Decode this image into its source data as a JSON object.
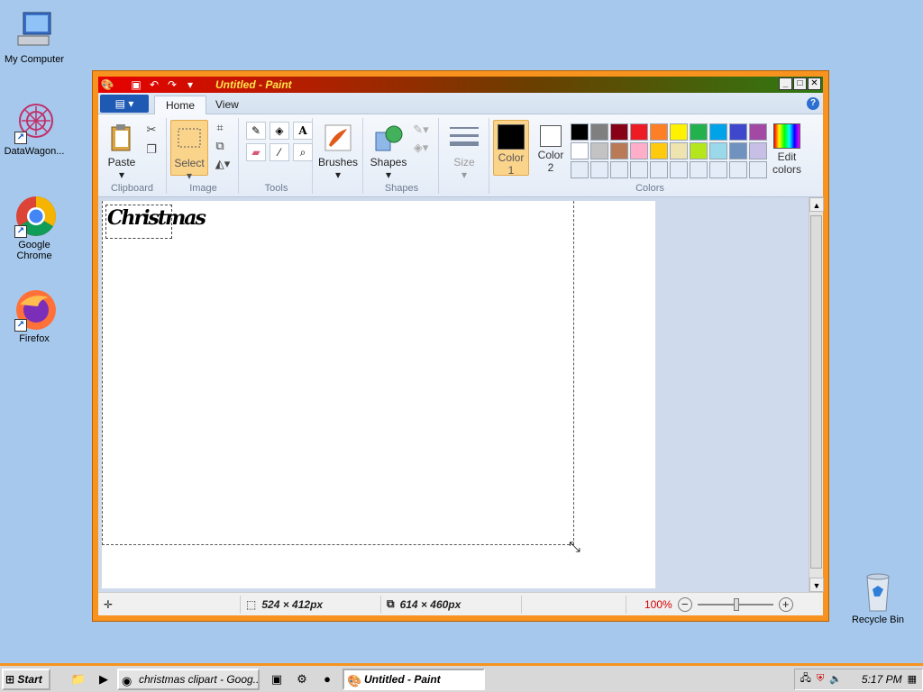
{
  "desktop": {
    "icons": [
      {
        "label": "My Computer"
      },
      {
        "label": "DataWagon..."
      },
      {
        "label": "Google Chrome"
      },
      {
        "label": "Firefox"
      },
      {
        "label": "Recycle Bin"
      }
    ]
  },
  "window": {
    "title": "Untitled - Paint",
    "tabs": [
      {
        "label": "Home"
      },
      {
        "label": "View"
      }
    ],
    "ribbon": {
      "clipboard": {
        "paste": "Paste",
        "group": "Clipboard"
      },
      "image": {
        "select": "Select",
        "group": "Image"
      },
      "tools": {
        "group": "Tools"
      },
      "brushes": {
        "label": "Brushes"
      },
      "shapes": {
        "label": "Shapes",
        "group": "Shapes"
      },
      "size": {
        "label": "Size"
      },
      "colors": {
        "color1": "Color\n1",
        "color1_a": "Color",
        "color1_b": "1",
        "color2_a": "Color",
        "color2_b": "2",
        "edit_a": "Edit",
        "edit_b": "colors",
        "group": "Colors",
        "color1_value": "#000000",
        "color2_value": "#ffffff",
        "palette": [
          "#000000",
          "#7f7f7f",
          "#880015",
          "#ed1c24",
          "#ff7f27",
          "#fff200",
          "#22b14c",
          "#00a2e8",
          "#3f48cc",
          "#a349a4",
          "#ffffff",
          "#c3c3c3",
          "#b97a57",
          "#ffaec9",
          "#ffc90e",
          "#efe4b0",
          "#b5e61d",
          "#99d9ea",
          "#7092be",
          "#c8bfe7",
          "#e4ecf7",
          "#e4ecf7",
          "#e4ecf7",
          "#e4ecf7",
          "#e4ecf7",
          "#e4ecf7",
          "#e4ecf7",
          "#e4ecf7",
          "#e4ecf7",
          "#e4ecf7"
        ]
      }
    },
    "canvas": {
      "clip_text": "Christmas"
    },
    "status": {
      "selection_size": "524 × 412px",
      "canvas_size": "614 × 460px",
      "zoom": "100%"
    }
  },
  "taskbar": {
    "start": "Start",
    "tasks": [
      {
        "label": "christmas clipart - Goog..."
      },
      {
        "label": "Untitled - Paint"
      }
    ],
    "clock": "5:17 PM"
  }
}
